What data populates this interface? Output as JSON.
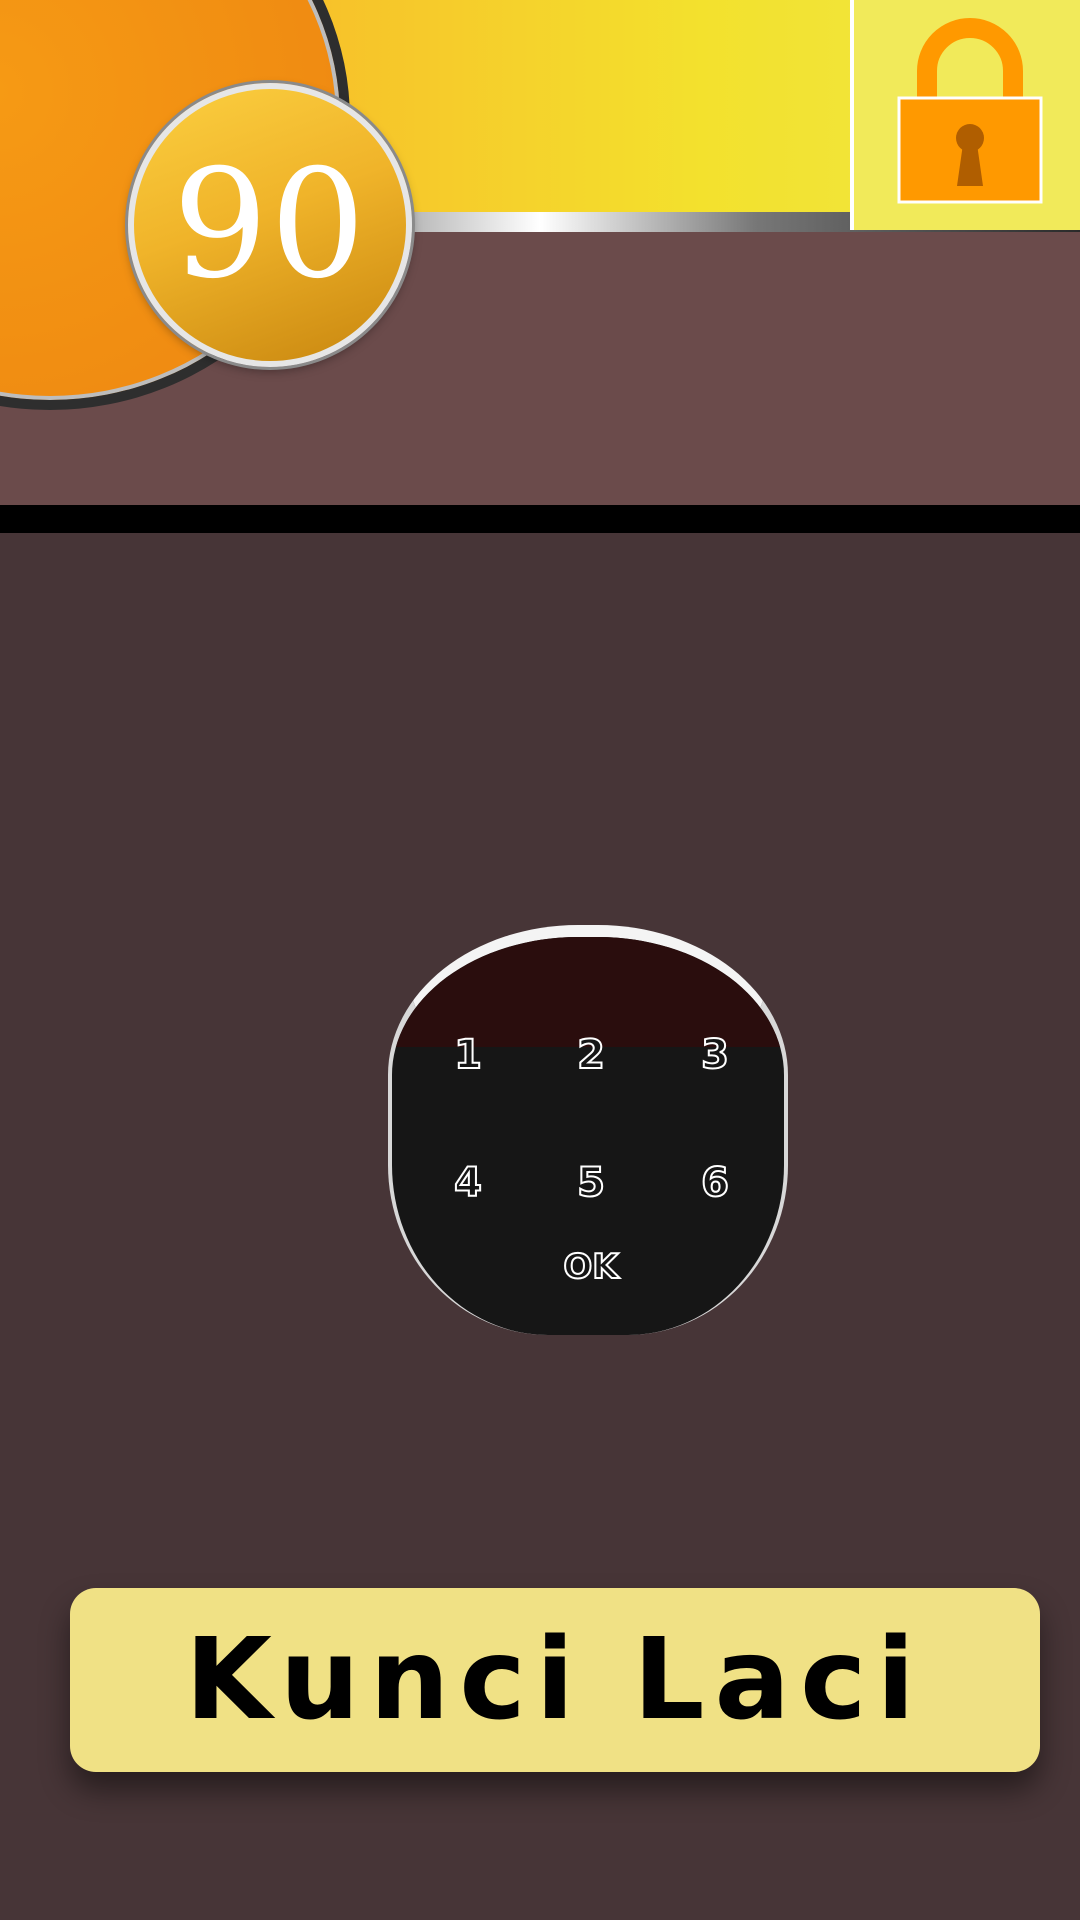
{
  "header": {
    "level": "90",
    "lock_icon": "padlock-icon",
    "colors": {
      "banner_orange": "#f39a14",
      "banner_yellow": "#f3e12d",
      "lock_orange": "#ff9900",
      "badge_gold": "#f0b42a",
      "band_brown": "#6b4b4b"
    }
  },
  "keypad": {
    "keys": [
      "1",
      "2",
      "3",
      "4",
      "5",
      "6"
    ],
    "ok_label": "OK"
  },
  "title": {
    "text": "Kunci Laci"
  },
  "colors": {
    "background": "#473537",
    "title_plate": "#f0e185"
  }
}
